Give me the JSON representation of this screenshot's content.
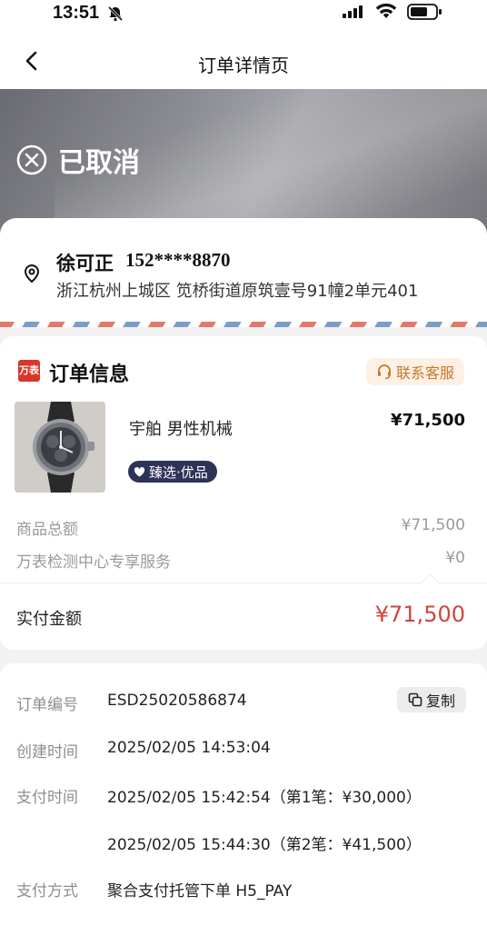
{
  "status_bar": {
    "time": "13:51",
    "icons": [
      "bell-off-icon",
      "signal-icon",
      "wifi-icon",
      "battery-icon"
    ]
  },
  "nav": {
    "title": "订单详情页",
    "back_icon": "chevron-left-icon"
  },
  "hero": {
    "status": "已取消",
    "icon": "cancel-circle-icon"
  },
  "address": {
    "name": "徐可正",
    "phone": "152****8870",
    "line": "浙江杭州上城区 笕桥街道原筑壹号91幢2单元401",
    "icon": "location-pin-icon"
  },
  "order": {
    "brand_logo": "万表",
    "section_title": "订单信息",
    "service_label": "联系客服",
    "product": {
      "name": "宇舶 男性机械",
      "price": "¥71,500",
      "badge": "臻选·优品"
    },
    "fees": [
      {
        "label": "商品总额",
        "value": "¥71,500"
      },
      {
        "label": "万表检测中心专享服务",
        "value": "¥0"
      }
    ],
    "paid": {
      "label": "实付金额",
      "value": "¥71,500"
    }
  },
  "info": {
    "order_no": {
      "label": "订单编号",
      "value": "ESD25020586874",
      "copy_label": "复制"
    },
    "created": {
      "label": "创建时间",
      "value": "2025/02/05 14:53:04"
    },
    "paid_time": {
      "label": "支付时间",
      "values": [
        "2025/02/05 15:42:54（第1笔：¥30,000）",
        "2025/02/05 15:44:30（第2笔：¥41,500）"
      ]
    },
    "method": {
      "label": "支付方式",
      "value": "聚合支付托管下单 H5_PAY"
    }
  },
  "colors": {
    "accent_red": "#d2443f",
    "service_orange": "#c9772b",
    "badge_navy": "#2e3358",
    "brand_red": "#d8362b"
  }
}
